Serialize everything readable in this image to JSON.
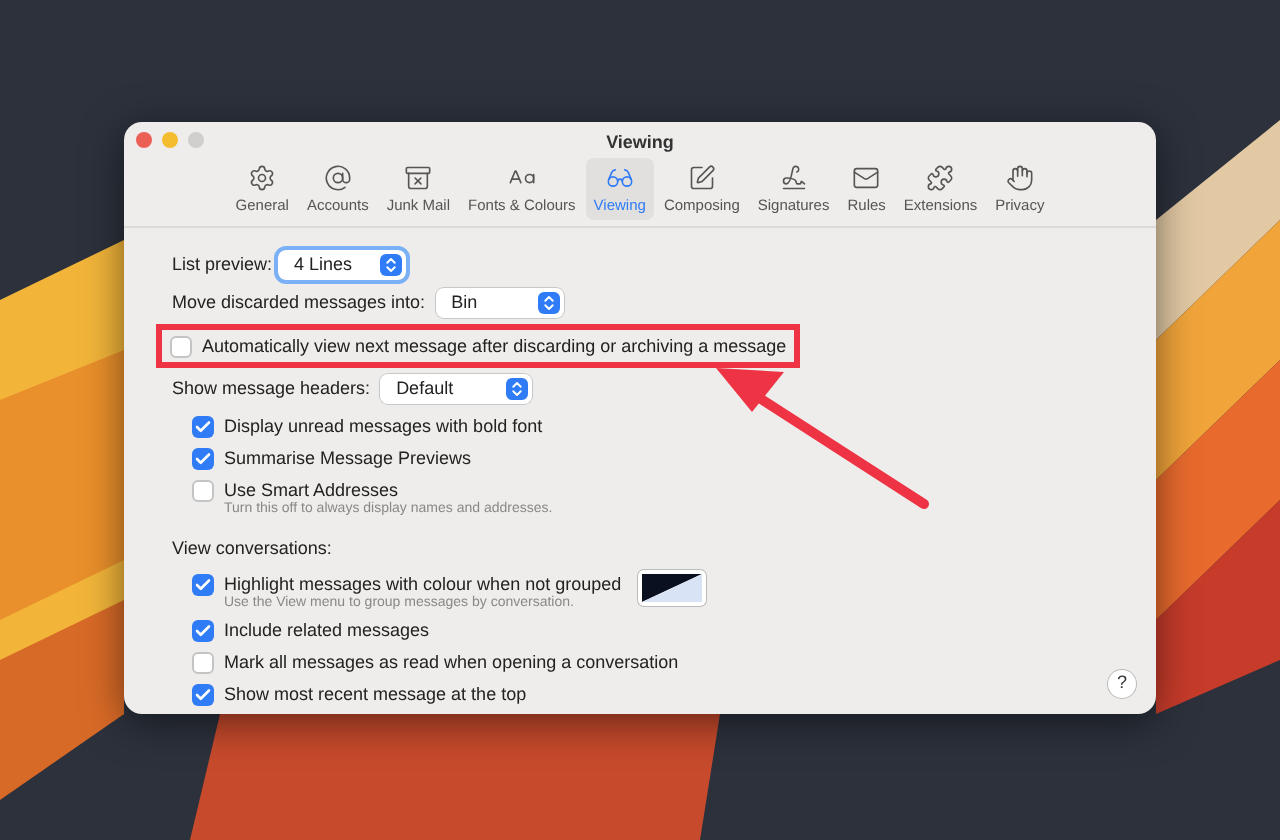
{
  "window": {
    "title": "Viewing"
  },
  "tabs": [
    {
      "label": "General",
      "selected": false
    },
    {
      "label": "Accounts",
      "selected": false
    },
    {
      "label": "Junk Mail",
      "selected": false
    },
    {
      "label": "Fonts & Colours",
      "selected": false
    },
    {
      "label": "Viewing",
      "selected": true
    },
    {
      "label": "Composing",
      "selected": false
    },
    {
      "label": "Signatures",
      "selected": false
    },
    {
      "label": "Rules",
      "selected": false
    },
    {
      "label": "Extensions",
      "selected": false
    },
    {
      "label": "Privacy",
      "selected": false
    }
  ],
  "list_preview": {
    "label": "List preview:",
    "value": "4 Lines",
    "focused": true
  },
  "move_discarded": {
    "label": "Move discarded messages into:",
    "value": "Bin",
    "focused": false
  },
  "auto_view": {
    "label": "Automatically view next message after discarding or archiving a message",
    "checked": false
  },
  "headers": {
    "label": "Show message headers:",
    "value": "Default",
    "focused": false
  },
  "header_options": [
    {
      "label": "Display unread messages with bold font",
      "checked": true
    },
    {
      "label": "Summarise Message Previews",
      "checked": true
    },
    {
      "label": "Use Smart Addresses",
      "checked": false,
      "hint": "Turn this off to always display names and addresses."
    }
  ],
  "conversations": {
    "label": "View conversations:"
  },
  "conversation_options": [
    {
      "label": "Highlight messages with colour when not grouped",
      "checked": true,
      "hint": "Use the View menu to group messages by conversation.",
      "swatch": true
    },
    {
      "label": "Include related messages",
      "checked": true
    },
    {
      "label": "Mark all messages as read when opening a conversation",
      "checked": false
    },
    {
      "label": "Show most recent message at the top",
      "checked": true
    }
  ],
  "help": {
    "label": "?"
  }
}
